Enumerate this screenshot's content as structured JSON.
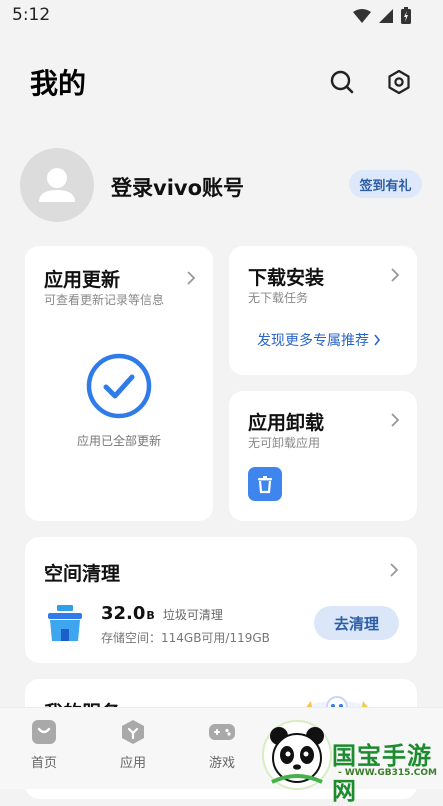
{
  "status_bar": {
    "time": "5:12"
  },
  "header": {
    "title": "我的"
  },
  "profile": {
    "name": "登录vivo账号",
    "signin_label": "签到有礼"
  },
  "app_update": {
    "title": "应用更新",
    "subtitle": "可查看更新记录等信息",
    "status": "应用已全部更新"
  },
  "download": {
    "title": "下载安装",
    "subtitle": "无下载任务",
    "link": "发现更多专属推荐"
  },
  "uninstall": {
    "title": "应用卸载",
    "subtitle": "无可卸载应用"
  },
  "storage": {
    "title": "空间清理",
    "value": "32.0",
    "unit": "B",
    "value_label": "垃圾可清理",
    "capacity": "存储空间：114GB可用/119GB",
    "clean_label": "去清理"
  },
  "services": {
    "title": "我的服务"
  },
  "bottom_nav": {
    "home": "首页",
    "apps": "应用",
    "games": "游戏"
  },
  "watermark": {
    "brand": "国宝手游网",
    "url": "- WWW.GB315.COM -"
  },
  "colors": {
    "accent": "#2b66c7",
    "icon_blue": "#2f7bea",
    "background": "#f3f3f3"
  }
}
